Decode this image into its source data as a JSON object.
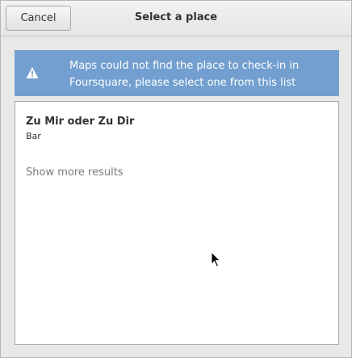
{
  "dialog": {
    "title": "Select a place",
    "cancel_label": "Cancel"
  },
  "infobar": {
    "icon": "warning-icon",
    "message": "Maps could not find the place to check-in in Foursquare, please select one from this list",
    "color": "#729fcf"
  },
  "places": [
    {
      "name": "Zu Mir oder Zu Dir",
      "type": "Bar"
    }
  ],
  "show_more_label": "Show more results"
}
